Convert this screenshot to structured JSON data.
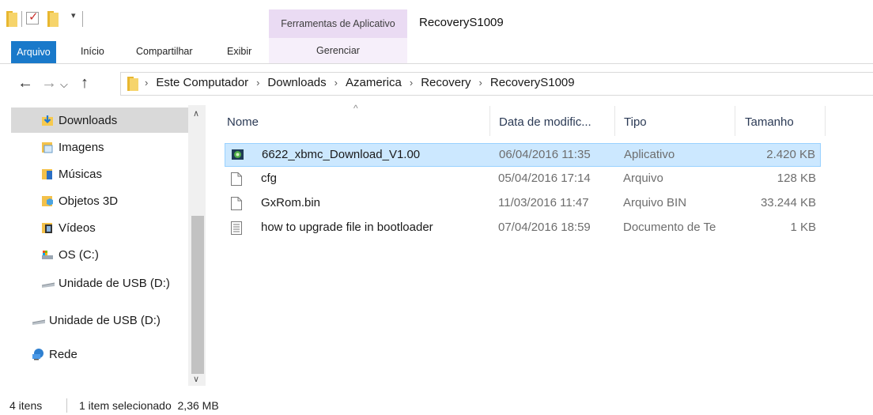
{
  "window": {
    "title": "RecoveryS1009"
  },
  "ribbon": {
    "context_group": "Ferramentas de Aplicativo",
    "context_tab": "Gerenciar",
    "tabs": [
      "Arquivo",
      "Início",
      "Compartilhar",
      "Exibir"
    ]
  },
  "address": {
    "breadcrumbs": [
      "Este Computador",
      "Downloads",
      "Azamerica",
      "Recovery",
      "RecoveryS1009"
    ]
  },
  "nav_pane": {
    "items": [
      {
        "label": "Downloads",
        "icon": "downloads-icon",
        "selected": true
      },
      {
        "label": "Imagens",
        "icon": "pictures-icon"
      },
      {
        "label": "Músicas",
        "icon": "music-icon"
      },
      {
        "label": "Objetos 3D",
        "icon": "3d-objects-icon"
      },
      {
        "label": "Vídeos",
        "icon": "videos-icon"
      },
      {
        "label": "OS (C:)",
        "icon": "drive-c-icon"
      },
      {
        "label": "Unidade de USB (D:)",
        "icon": "usb-drive-icon"
      },
      {
        "label": "Unidade de USB (D:)",
        "icon": "usb-drive-icon"
      },
      {
        "label": "Rede",
        "icon": "network-icon"
      }
    ]
  },
  "file_list": {
    "columns": {
      "name": "Nome",
      "date": "Data de modific...",
      "type": "Tipo",
      "size": "Tamanho"
    },
    "rows": [
      {
        "name": "6622_xbmc_Download_V1.00",
        "date": "06/04/2016 11:35",
        "type": "Aplicativo",
        "size": "2.420 KB",
        "icon": "application-icon",
        "selected": true
      },
      {
        "name": "cfg",
        "date": "05/04/2016 17:14",
        "type": "Arquivo",
        "size": "128 KB",
        "icon": "file-icon"
      },
      {
        "name": "GxRom.bin",
        "date": "11/03/2016 11:47",
        "type": "Arquivo BIN",
        "size": "33.244 KB",
        "icon": "file-icon"
      },
      {
        "name": "how to upgrade file in bootloader",
        "date": "07/04/2016 18:59",
        "type": "Documento de Te",
        "size": "1 KB",
        "icon": "text-document-icon"
      }
    ]
  },
  "status": {
    "count": "4 itens",
    "selection": "1 item selecionado  2,36 MB"
  },
  "colors": {
    "accent": "#1979ca",
    "context": "#eadbf3",
    "selection": "#cce8ff"
  }
}
